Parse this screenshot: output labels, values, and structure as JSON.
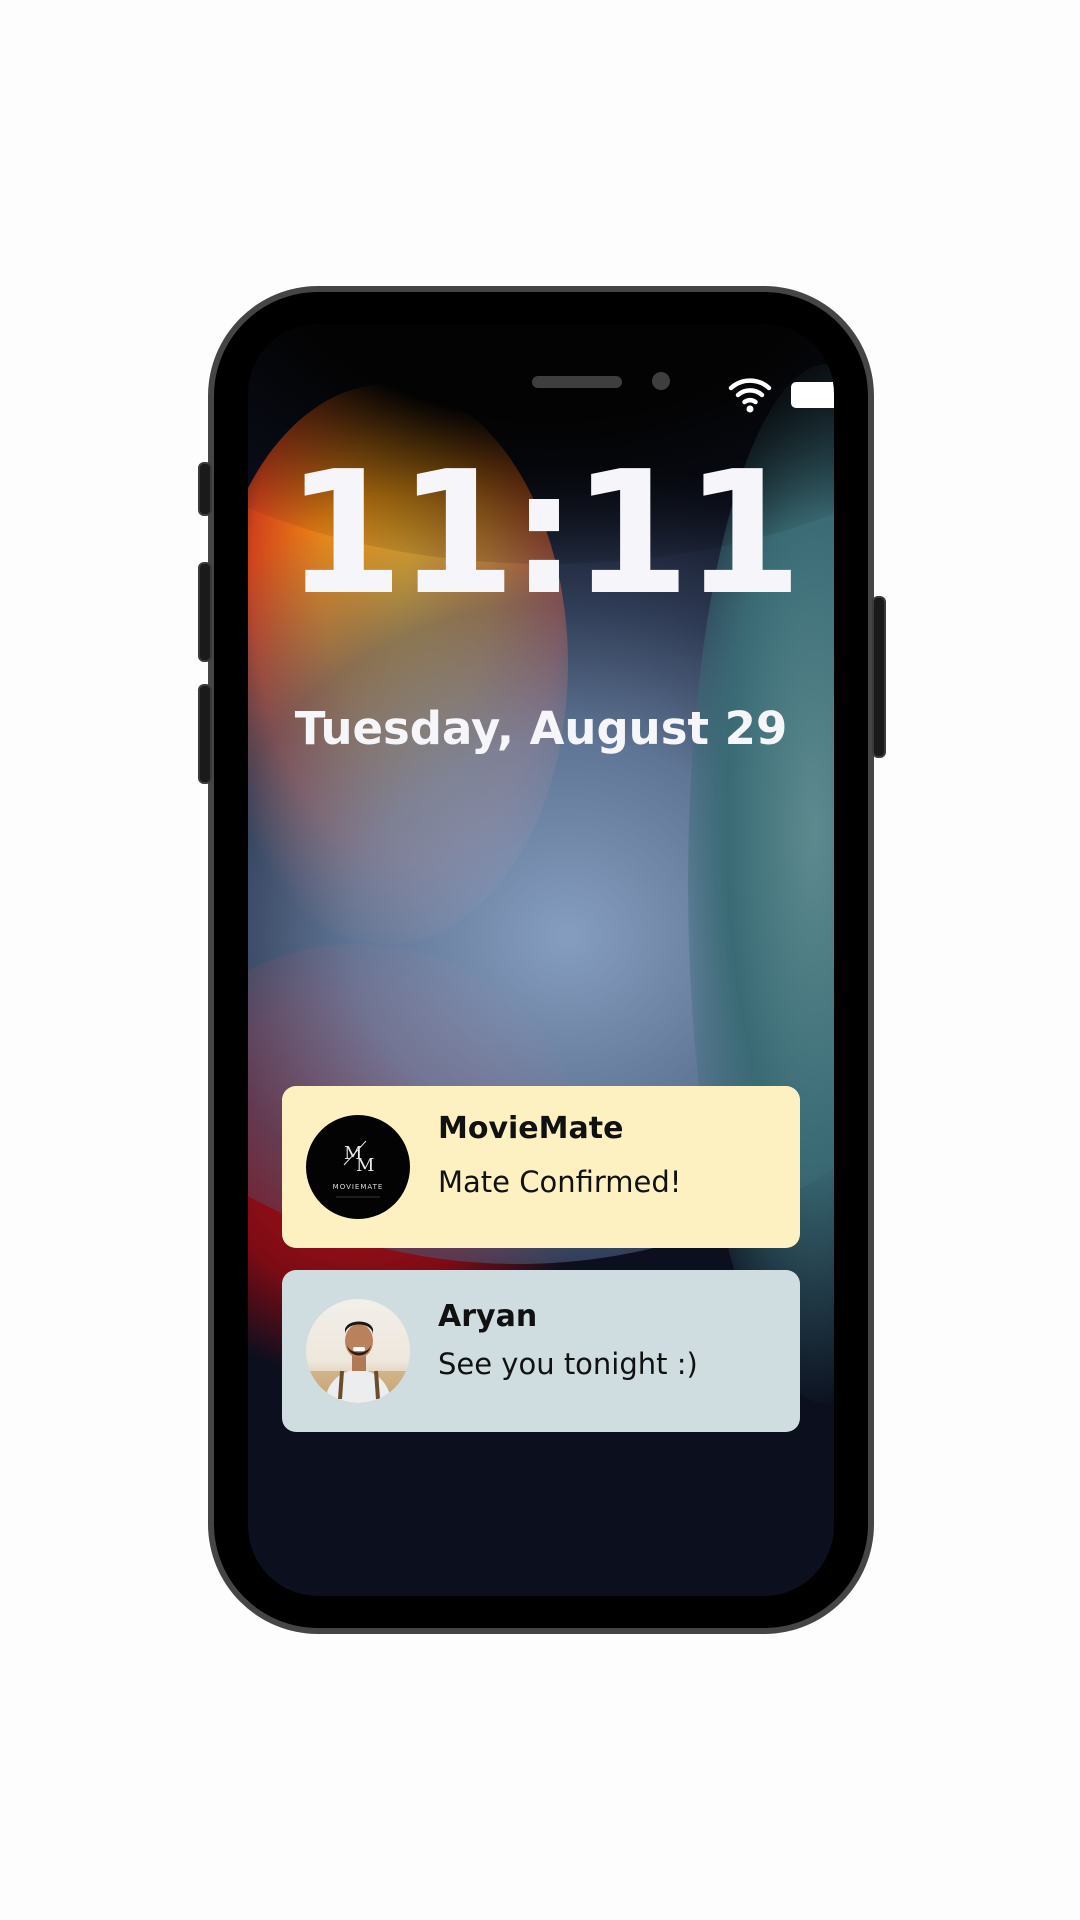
{
  "lockscreen": {
    "time": "11:11",
    "date": "Tuesday, August 29"
  },
  "status_bar": {
    "wifi_icon": "wifi-icon",
    "battery_icon": "battery-icon"
  },
  "notifications": [
    {
      "app": "MovieMate",
      "message": "Mate Confirmed!",
      "avatar": "moviemate-logo",
      "logo_text": "MOVIEMATE",
      "background": "#fdf1c1"
    },
    {
      "app": "Aryan",
      "message": "See you tonight :)",
      "avatar": "contact-photo",
      "background": "#d0dde0"
    }
  ]
}
